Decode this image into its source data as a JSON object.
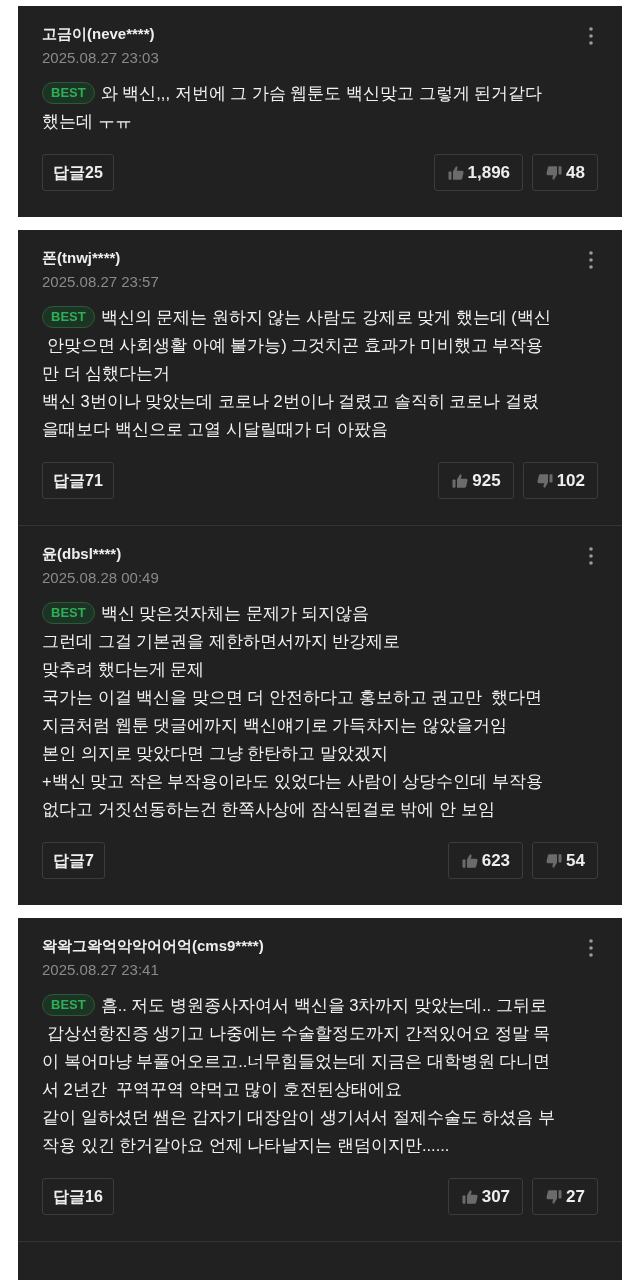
{
  "panels": [
    {
      "comments": [
        {
          "author": "고금이(neve****)",
          "date": "2025.08.27 23:03",
          "best": true,
          "badge": "BEST",
          "body": "와 백신,,, 저번에 그 가슴 웹툰도 백신맞고 그렇게 된거같다\n했는데 ㅜㅠ",
          "replies": "답글25",
          "likes": "1,896",
          "dislikes": "48"
        }
      ]
    },
    {
      "comments": [
        {
          "author": "폰(tnwj****)",
          "date": "2025.08.27 23:57",
          "best": true,
          "badge": "BEST",
          "body": "백신의 문제는 원하지 않는 사람도 강제로 맞게 했는데 (백신\n 안맞으면 사회생활 아예 불가능) 그것치곤 효과가 미비했고 부작용\n만 더 심했다는거\n백신 3번이나 맞았는데 코로나 2번이나 걸렸고 솔직히 코로나 걸렸\n을때보다 백신으로 고열 시달릴때가 더 아팠음",
          "replies": "답글71",
          "likes": "925",
          "dislikes": "102"
        },
        {
          "author": "윤(dbsl****)",
          "date": "2025.08.28 00:49",
          "best": true,
          "badge": "BEST",
          "body": "백신 맞은것자체는 문제가 되지않음\n그런데 그걸 기본권을 제한하면서까지 반강제로\n맞추려 했다는게 문제\n국가는 이걸 백신을 맞으면 더 안전하다고 홍보하고 권고만  했다면\n지금처럼 웹툰 댓글에까지 백신얘기로 가득차지는 않았을거임\n본인 의지로 맞았다면 그냥 한탄하고 말았겠지\n+백신 맞고 작은 부작용이라도 있었다는 사람이 상당수인데 부작용\n없다고 거짓선동하는건 한쪽사상에 잠식된걸로 밖에 안 보임",
          "replies": "답글7",
          "likes": "623",
          "dislikes": "54"
        }
      ]
    },
    {
      "comments": [
        {
          "author": "왁왁그왁억악악어어억(cms9****)",
          "date": "2025.08.27 23:41",
          "best": true,
          "badge": "BEST",
          "body": "흠.. 저도 병원종사자여서 백신을 3차까지 맞았는데.. 그뒤로\n 갑상선항진증 생기고 나중에는 수술할정도까지 간적있어요 정말 목\n이 복어마냥 부풀어오르고..너무힘들었는데 지금은 대학병원 다니면\n서 2년간  꾸역꾸역 약먹고 많이 호전된상태에요\n같이 일하셨던 쌤은 갑자기 대장암이 생기셔서 절제수술도 하셨음 부\n작용 있긴 한거같아요 언제 나타날지는 랜덤이지만......",
          "replies": "답글16",
          "likes": "307",
          "dislikes": "27"
        }
      ]
    }
  ]
}
